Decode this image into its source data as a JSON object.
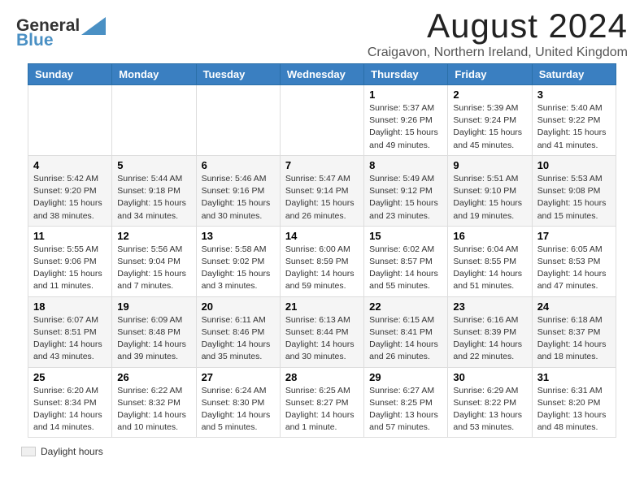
{
  "header": {
    "logo_general": "General",
    "logo_blue": "Blue",
    "month_title": "August 2024",
    "subtitle": "Craigavon, Northern Ireland, United Kingdom"
  },
  "days_of_week": [
    "Sunday",
    "Monday",
    "Tuesday",
    "Wednesday",
    "Thursday",
    "Friday",
    "Saturday"
  ],
  "weeks": [
    [
      {
        "day": "",
        "info": ""
      },
      {
        "day": "",
        "info": ""
      },
      {
        "day": "",
        "info": ""
      },
      {
        "day": "",
        "info": ""
      },
      {
        "day": "1",
        "info": "Sunrise: 5:37 AM\nSunset: 9:26 PM\nDaylight: 15 hours\nand 49 minutes."
      },
      {
        "day": "2",
        "info": "Sunrise: 5:39 AM\nSunset: 9:24 PM\nDaylight: 15 hours\nand 45 minutes."
      },
      {
        "day": "3",
        "info": "Sunrise: 5:40 AM\nSunset: 9:22 PM\nDaylight: 15 hours\nand 41 minutes."
      }
    ],
    [
      {
        "day": "4",
        "info": "Sunrise: 5:42 AM\nSunset: 9:20 PM\nDaylight: 15 hours\nand 38 minutes."
      },
      {
        "day": "5",
        "info": "Sunrise: 5:44 AM\nSunset: 9:18 PM\nDaylight: 15 hours\nand 34 minutes."
      },
      {
        "day": "6",
        "info": "Sunrise: 5:46 AM\nSunset: 9:16 PM\nDaylight: 15 hours\nand 30 minutes."
      },
      {
        "day": "7",
        "info": "Sunrise: 5:47 AM\nSunset: 9:14 PM\nDaylight: 15 hours\nand 26 minutes."
      },
      {
        "day": "8",
        "info": "Sunrise: 5:49 AM\nSunset: 9:12 PM\nDaylight: 15 hours\nand 23 minutes."
      },
      {
        "day": "9",
        "info": "Sunrise: 5:51 AM\nSunset: 9:10 PM\nDaylight: 15 hours\nand 19 minutes."
      },
      {
        "day": "10",
        "info": "Sunrise: 5:53 AM\nSunset: 9:08 PM\nDaylight: 15 hours\nand 15 minutes."
      }
    ],
    [
      {
        "day": "11",
        "info": "Sunrise: 5:55 AM\nSunset: 9:06 PM\nDaylight: 15 hours\nand 11 minutes."
      },
      {
        "day": "12",
        "info": "Sunrise: 5:56 AM\nSunset: 9:04 PM\nDaylight: 15 hours\nand 7 minutes."
      },
      {
        "day": "13",
        "info": "Sunrise: 5:58 AM\nSunset: 9:02 PM\nDaylight: 15 hours\nand 3 minutes."
      },
      {
        "day": "14",
        "info": "Sunrise: 6:00 AM\nSunset: 8:59 PM\nDaylight: 14 hours\nand 59 minutes."
      },
      {
        "day": "15",
        "info": "Sunrise: 6:02 AM\nSunset: 8:57 PM\nDaylight: 14 hours\nand 55 minutes."
      },
      {
        "day": "16",
        "info": "Sunrise: 6:04 AM\nSunset: 8:55 PM\nDaylight: 14 hours\nand 51 minutes."
      },
      {
        "day": "17",
        "info": "Sunrise: 6:05 AM\nSunset: 8:53 PM\nDaylight: 14 hours\nand 47 minutes."
      }
    ],
    [
      {
        "day": "18",
        "info": "Sunrise: 6:07 AM\nSunset: 8:51 PM\nDaylight: 14 hours\nand 43 minutes."
      },
      {
        "day": "19",
        "info": "Sunrise: 6:09 AM\nSunset: 8:48 PM\nDaylight: 14 hours\nand 39 minutes."
      },
      {
        "day": "20",
        "info": "Sunrise: 6:11 AM\nSunset: 8:46 PM\nDaylight: 14 hours\nand 35 minutes."
      },
      {
        "day": "21",
        "info": "Sunrise: 6:13 AM\nSunset: 8:44 PM\nDaylight: 14 hours\nand 30 minutes."
      },
      {
        "day": "22",
        "info": "Sunrise: 6:15 AM\nSunset: 8:41 PM\nDaylight: 14 hours\nand 26 minutes."
      },
      {
        "day": "23",
        "info": "Sunrise: 6:16 AM\nSunset: 8:39 PM\nDaylight: 14 hours\nand 22 minutes."
      },
      {
        "day": "24",
        "info": "Sunrise: 6:18 AM\nSunset: 8:37 PM\nDaylight: 14 hours\nand 18 minutes."
      }
    ],
    [
      {
        "day": "25",
        "info": "Sunrise: 6:20 AM\nSunset: 8:34 PM\nDaylight: 14 hours\nand 14 minutes."
      },
      {
        "day": "26",
        "info": "Sunrise: 6:22 AM\nSunset: 8:32 PM\nDaylight: 14 hours\nand 10 minutes."
      },
      {
        "day": "27",
        "info": "Sunrise: 6:24 AM\nSunset: 8:30 PM\nDaylight: 14 hours\nand 5 minutes."
      },
      {
        "day": "28",
        "info": "Sunrise: 6:25 AM\nSunset: 8:27 PM\nDaylight: 14 hours\nand 1 minute."
      },
      {
        "day": "29",
        "info": "Sunrise: 6:27 AM\nSunset: 8:25 PM\nDaylight: 13 hours\nand 57 minutes."
      },
      {
        "day": "30",
        "info": "Sunrise: 6:29 AM\nSunset: 8:22 PM\nDaylight: 13 hours\nand 53 minutes."
      },
      {
        "day": "31",
        "info": "Sunrise: 6:31 AM\nSunset: 8:20 PM\nDaylight: 13 hours\nand 48 minutes."
      }
    ]
  ],
  "legend": {
    "label": "Daylight hours"
  }
}
